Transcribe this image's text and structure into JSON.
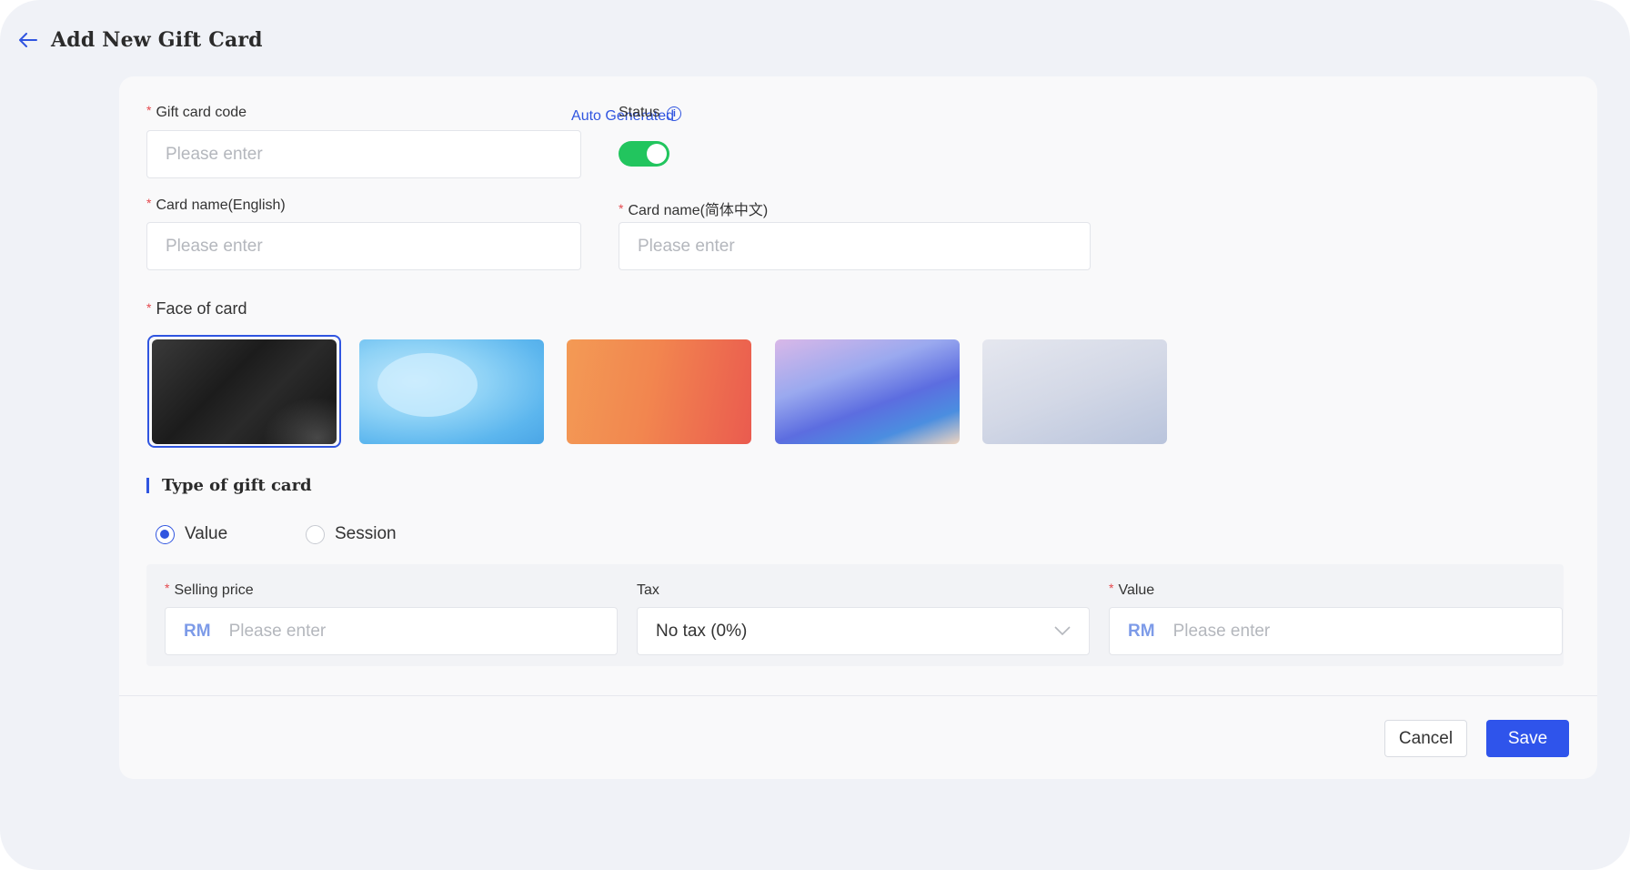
{
  "header": {
    "title": "Add New Gift Card",
    "back_icon": "arrow-left-icon"
  },
  "form": {
    "gift_code": {
      "label": "Gift card code",
      "required": "*",
      "placeholder": "Please enter",
      "auto_generate_label": "Auto Generated"
    },
    "status": {
      "label": "Status",
      "info_icon": "i",
      "enabled": true
    },
    "card_name_en": {
      "label": "Card name(English)",
      "required": "*",
      "placeholder": "Please enter"
    },
    "card_name_cn": {
      "label": "Card name(简体中文)",
      "required": "*",
      "placeholder": "Please enter"
    },
    "face": {
      "label": "Face of card",
      "required": "*",
      "options": [
        "dark",
        "blue",
        "orange",
        "purple",
        "silver"
      ],
      "selected_index": 0
    },
    "type": {
      "title": "Type of gift card",
      "options": [
        {
          "label": "Value",
          "checked": true
        },
        {
          "label": "Session",
          "checked": false
        }
      ]
    },
    "selling_price": {
      "label": "Selling price",
      "required": "*",
      "prefix": "RM",
      "placeholder": "Please enter"
    },
    "tax": {
      "label": "Tax",
      "value": "No tax (0%)"
    },
    "value": {
      "label": "Value",
      "required": "*",
      "prefix": "RM",
      "placeholder": "Please enter"
    }
  },
  "actions": {
    "cancel_label": "Cancel",
    "save_label": "Save"
  },
  "colors": {
    "accent": "#2f54eb",
    "toggle_on": "#22c55e",
    "required": "#e5484d",
    "background": "#f0f2f7"
  }
}
